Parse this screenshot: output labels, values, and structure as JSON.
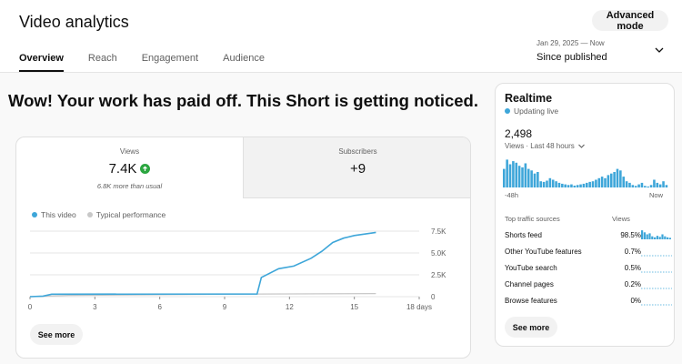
{
  "page": {
    "title": "Video analytics",
    "advanced_mode": "Advanced mode",
    "tabs": [
      "Overview",
      "Reach",
      "Engagement",
      "Audience"
    ],
    "date_range": {
      "label": "Jan 29, 2025 — Now",
      "value": "Since published"
    },
    "headline": "Wow! Your work has paid off. This Short is getting noticed."
  },
  "metrics": {
    "views": {
      "label": "Views",
      "value": "7.4K",
      "note": "6.8K more than usual"
    },
    "subscribers": {
      "label": "Subscribers",
      "value": "+9"
    }
  },
  "legend": {
    "this_video": "This video",
    "typical": "Typical performance"
  },
  "see_more": "See more",
  "colors": {
    "accent": "#3ea6d9",
    "typical": "#c8c8c8",
    "up": "#2ba640",
    "live": "#3ea6d9"
  },
  "chart_data": {
    "type": "line",
    "series": [
      {
        "name": "This video",
        "points": [
          [
            0,
            0
          ],
          [
            0.6,
            60
          ],
          [
            1,
            280
          ],
          [
            10.5,
            300
          ],
          [
            10.7,
            2200
          ],
          [
            11.5,
            3200
          ],
          [
            12.2,
            3500
          ],
          [
            13,
            4400
          ],
          [
            13.5,
            5200
          ],
          [
            14,
            6200
          ],
          [
            14.5,
            6700
          ],
          [
            15,
            7000
          ],
          [
            16,
            7350
          ]
        ]
      },
      {
        "name": "Typical performance",
        "points": [
          [
            0,
            0
          ],
          [
            0.6,
            40
          ],
          [
            1.8,
            150
          ],
          [
            10.6,
            300
          ],
          [
            16,
            350
          ]
        ]
      }
    ],
    "x_ticks": [
      "0",
      "3",
      "6",
      "9",
      "12",
      "15",
      "18 days"
    ],
    "y_ticks": [
      "0",
      "2.5K",
      "5.0K",
      "7.5K"
    ],
    "xlim": [
      0,
      18
    ],
    "ylim": [
      0,
      7500
    ]
  },
  "realtime": {
    "title": "Realtime",
    "status": "Updating live",
    "count": "2,498",
    "subtitle": "Views · Last 48 hours",
    "axis_start": "-48h",
    "axis_end": "Now",
    "bars": [
      0.6,
      0.9,
      0.75,
      0.85,
      0.8,
      0.7,
      0.65,
      0.78,
      0.6,
      0.55,
      0.45,
      0.5,
      0.2,
      0.18,
      0.22,
      0.3,
      0.25,
      0.2,
      0.15,
      0.12,
      0.1,
      0.08,
      0.1,
      0.06,
      0.08,
      0.1,
      0.12,
      0.15,
      0.18,
      0.2,
      0.25,
      0.3,
      0.35,
      0.3,
      0.4,
      0.45,
      0.5,
      0.6,
      0.55,
      0.35,
      0.2,
      0.15,
      0.08,
      0.05,
      0.1,
      0.15,
      0.05,
      0.03,
      0.08,
      0.25,
      0.15,
      0.1,
      0.2,
      0.08
    ],
    "sources_title": "Top traffic sources",
    "sources_col": "Views",
    "sources": [
      {
        "name": "Shorts feed",
        "pct": "98.5%"
      },
      {
        "name": "Other YouTube features",
        "pct": "0.7%"
      },
      {
        "name": "YouTube search",
        "pct": "0.5%"
      },
      {
        "name": "Channel pages",
        "pct": "0.2%"
      },
      {
        "name": "Browse features",
        "pct": "0%"
      }
    ]
  }
}
